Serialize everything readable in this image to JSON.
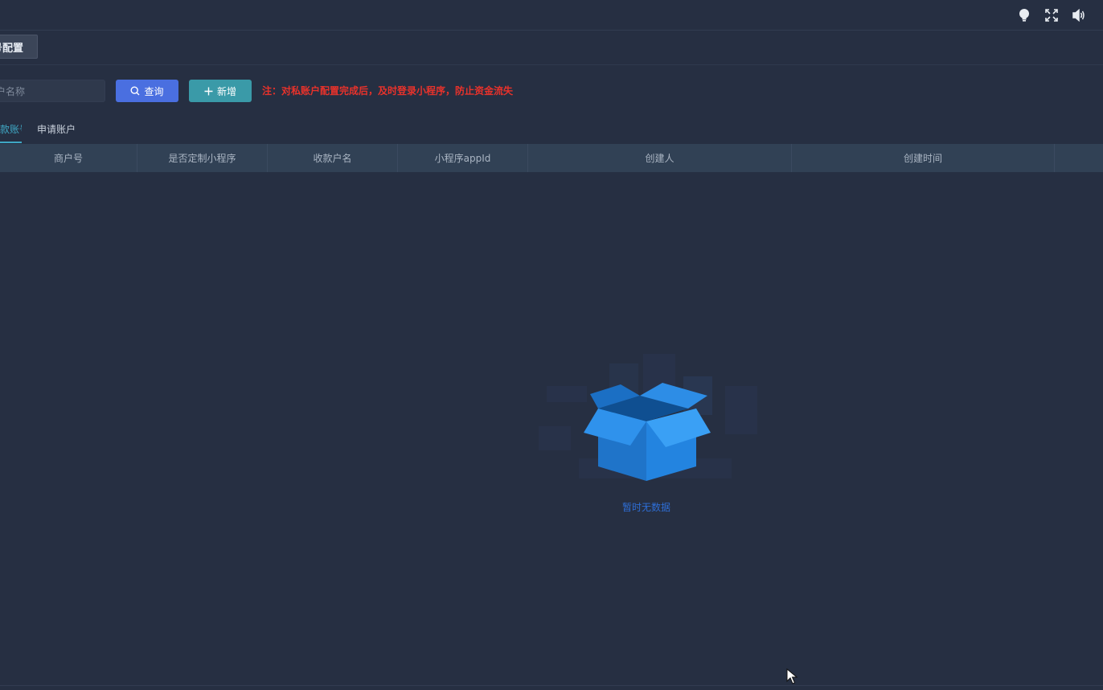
{
  "topbar": {
    "icons": [
      "bulb-icon",
      "fullscreen-icon",
      "speaker-icon"
    ]
  },
  "tags": {
    "active_tag": "账号配置"
  },
  "toolbar": {
    "search_placeholder": "账户名称",
    "query_label": "查询",
    "add_label": "新增",
    "notice": "注：对私账户配置完成后，及时登录小程序，防止资金流失"
  },
  "tabs": [
    {
      "label": "收款账号",
      "active": true
    },
    {
      "label": "申请账户",
      "active": false
    }
  ],
  "table": {
    "columns": [
      "商户号",
      "是否定制小程序",
      "收款户名",
      "小程序appId",
      "创建人",
      "创建时间"
    ],
    "rows": []
  },
  "empty_state": {
    "text": "暂时无数据",
    "icon": "open-box-icon"
  },
  "colors": {
    "background": "#262f42",
    "primary": "#4a6fe0",
    "teal": "#3a9aa8",
    "danger": "#e8322b",
    "tab_active": "#3fa7c4",
    "empty_text": "#2e6ed6"
  }
}
